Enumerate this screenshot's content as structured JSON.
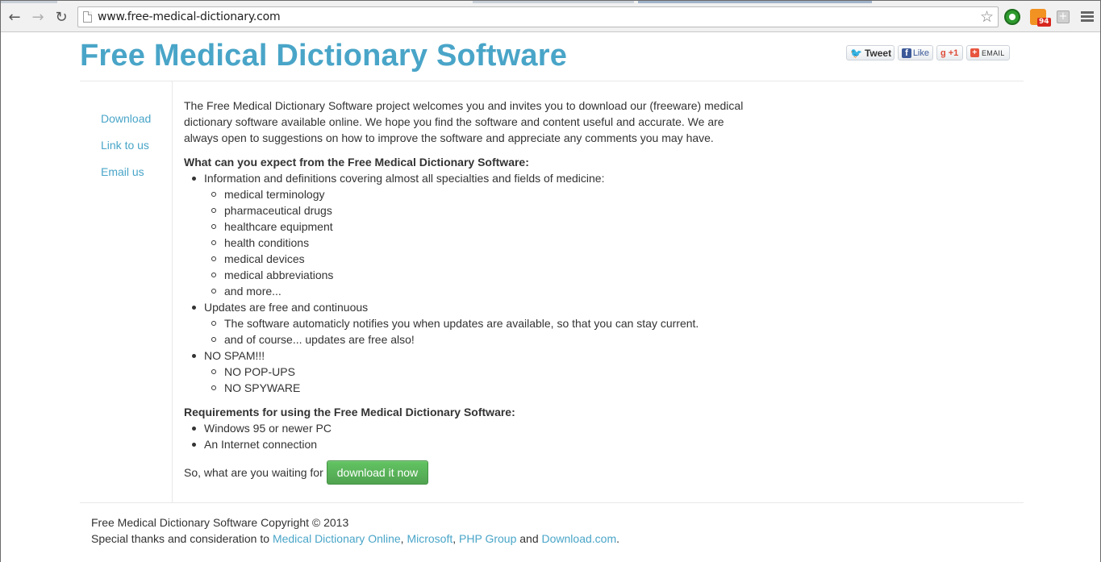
{
  "browser": {
    "url": "www.free-medical-dictionary.com",
    "rss_badge": "94"
  },
  "header": {
    "title": "Free Medical Dictionary Software",
    "social": {
      "tweet": "Tweet",
      "like": "Like",
      "plus_one": "+1",
      "email": "EMAIL"
    }
  },
  "sidebar": {
    "items": [
      {
        "label": "Download"
      },
      {
        "label": "Link to us"
      },
      {
        "label": "Email us"
      }
    ]
  },
  "main": {
    "intro": "The Free Medical Dictionary Software project welcomes you and invites you to download our (freeware) medical dictionary software available online. We hope you find the software and content useful and accurate. We are always open to suggestions on how to improve the software and appreciate any comments you may have.",
    "expect_heading": "What can you expect from the Free Medical Dictionary Software:",
    "expect_items": [
      {
        "text": "Information and definitions covering almost all specialties and fields of medicine:",
        "sub": [
          "medical terminology",
          "pharmaceutical drugs",
          "healthcare equipment",
          "health conditions",
          "medical devices",
          "medical abbreviations",
          "and more..."
        ]
      },
      {
        "text": "Updates are free and continuous",
        "sub": [
          "The software automaticly notifies you when updates are available, so that you can stay current.",
          "and of course... updates are free also!"
        ]
      },
      {
        "text": "NO SPAM!!!",
        "sub": [
          "NO POP-UPS",
          "NO SPYWARE"
        ]
      }
    ],
    "requirements_heading": "Requirements for using the Free Medical Dictionary Software:",
    "requirements": [
      "Windows 95 or newer PC",
      "An Internet connection"
    ],
    "waiting_text": "So, what are you waiting for",
    "download_button": "download it now"
  },
  "footer": {
    "copyright": "Free Medical Dictionary Software Copyright © 2013",
    "thanks_prefix": "Special thanks and consideration to ",
    "link1": "Medical Dictionary Online",
    "sep1": ", ",
    "link2": "Microsoft",
    "sep2": ", ",
    "link3": "PHP Group",
    "and_text": " and ",
    "link4": "Download.com",
    "end": "."
  }
}
